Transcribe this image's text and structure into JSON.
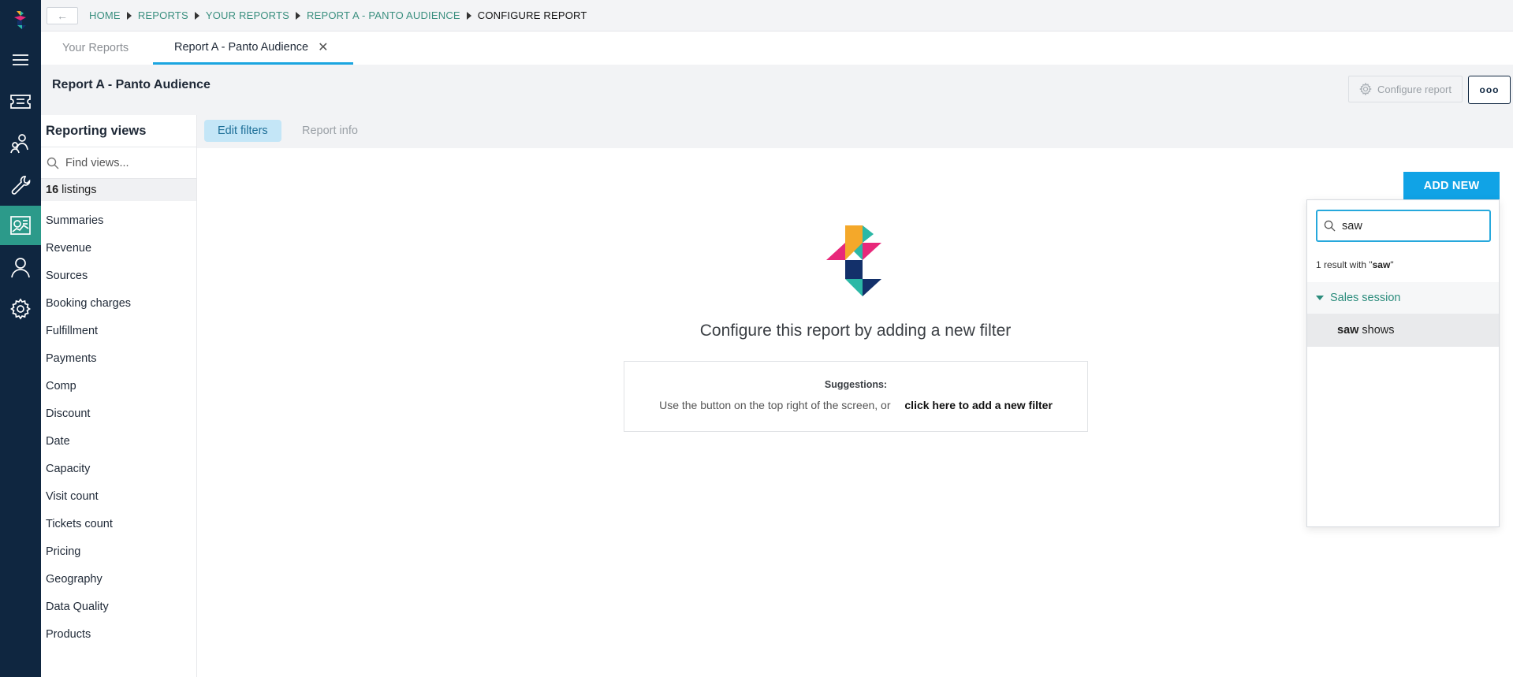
{
  "breadcrumb": {
    "items": [
      "HOME",
      "REPORTS",
      "YOUR REPORTS",
      "REPORT A - PANTO AUDIENCE",
      "CONFIGURE REPORT"
    ]
  },
  "tabs": {
    "your_reports": "Your Reports",
    "active": "Report A - Panto Audience"
  },
  "header": {
    "title": "Report A - Panto Audience",
    "configure_label": "Configure report",
    "more_label": "ooo"
  },
  "sidebar": {
    "title": "Reporting views",
    "search_placeholder": "Find views...",
    "listings_count": "16",
    "listings_label": "listings",
    "items": [
      "Summaries",
      "Revenue",
      "Sources",
      "Booking charges",
      "Fulfillment",
      "Payments",
      "Comp",
      "Discount",
      "Date",
      "Capacity",
      "Visit count",
      "Tickets count",
      "Pricing",
      "Geography",
      "Data Quality",
      "Products"
    ]
  },
  "subtabs": {
    "edit_filters": "Edit filters",
    "report_info": "Report info"
  },
  "main": {
    "add_new": "ADD NEW",
    "message": "Configure this report by adding a new filter",
    "suggestions_title": "Suggestions:",
    "suggestion_text": "Use the button on the top right of the screen, or",
    "suggestion_link": "click here to add a new filter"
  },
  "dropdown": {
    "search_value": "saw",
    "result_prefix": "1 result with \"",
    "result_term": "saw",
    "result_suffix": "\"",
    "group": "Sales session",
    "item_bold": "saw",
    "item_rest": "shows"
  },
  "colors": {
    "rail_bg": "#0f2640",
    "accent_teal": "#2c9a8a",
    "accent_blue": "#10a3e6",
    "logo_pink": "#e8287a",
    "logo_orange": "#f4a82a",
    "logo_navy": "#13306a",
    "logo_teal": "#2bb8a6"
  },
  "icons": [
    "logo-icon",
    "menu-icon",
    "ticket-icon",
    "audience-icon",
    "tools-icon",
    "reports-icon",
    "user-icon",
    "settings-icon",
    "back-arrow-icon",
    "close-icon",
    "gear-icon",
    "search-icon",
    "caret-down-icon"
  ]
}
